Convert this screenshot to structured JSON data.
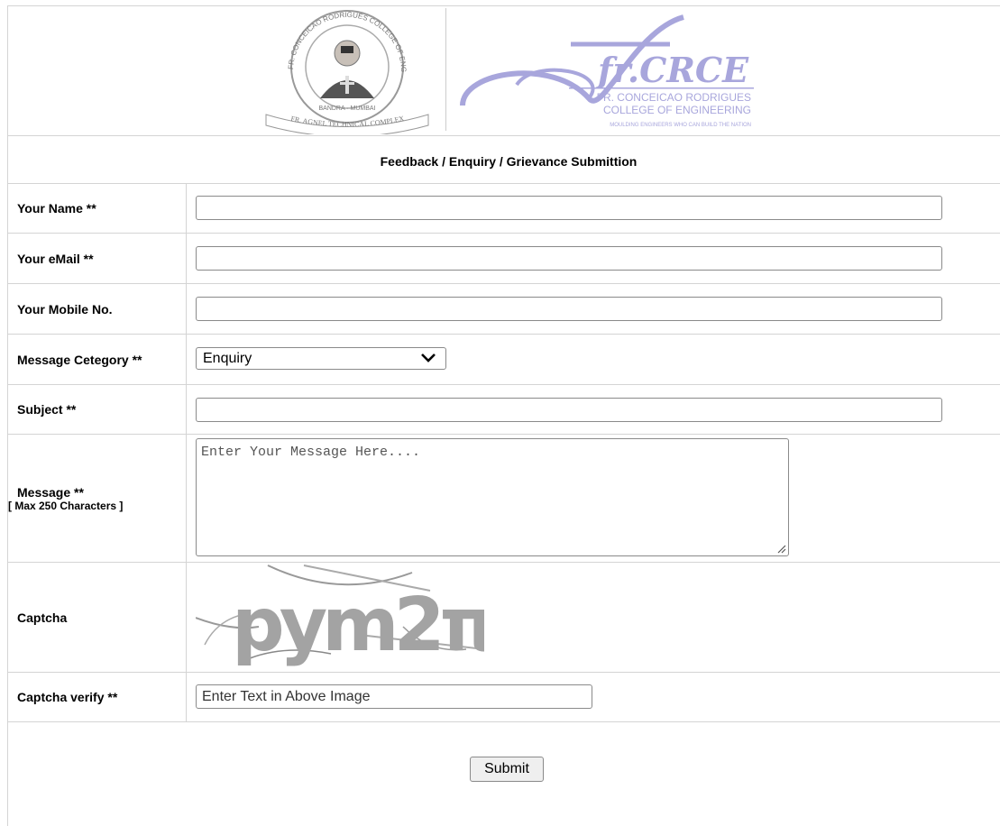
{
  "logos": {
    "seal_text_top": "FR. CONCEICAO RODRIGUES COLLEGE OF ENGINEERING",
    "seal_text_city": "BANDRA · MUMBAI",
    "seal_text_bottom": "FR. AGNEL TECHNICAL COMPLEX",
    "brand_mark": "fr.CRCE",
    "brand_line1": "FR. CONCEICAO RODRIGUES",
    "brand_line2": "COLLEGE OF ENGINEERING",
    "brand_tagline": "MOULDING ENGINEERS WHO CAN BUILD THE NATION",
    "brand_color": "#a8a6dc"
  },
  "form": {
    "title": "Feedback / Enquiry / Grievance Submittion",
    "name_label": "Your Name **",
    "name_value": "",
    "email_label": "Your eMail **",
    "email_value": "",
    "mobile_label": "Your Mobile No.",
    "mobile_value": "",
    "category_label": "Message Cetegory **",
    "category_selected": "Enquiry",
    "subject_label": "Subject **",
    "subject_value": "",
    "message_label": "Message **",
    "message_hint": "[ Max 250 Characters ]",
    "message_placeholder": "Enter Your Message Here....",
    "captcha_label": "Captcha",
    "captcha_text": "pym2π",
    "captcha_verify_label": "Captcha verify **",
    "captcha_verify_placeholder": "Enter Text in Above Image",
    "submit_label": "Submit"
  }
}
